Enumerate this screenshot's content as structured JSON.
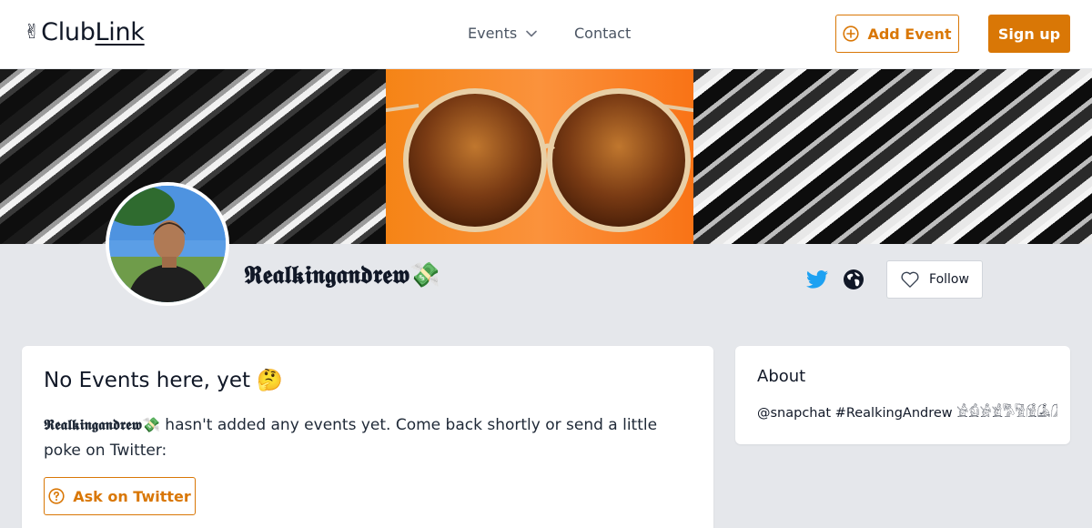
{
  "header": {
    "logo_emoji": "✌",
    "logo_text_a": "Club",
    "logo_text_b": "Link",
    "nav_events": "Events",
    "nav_contact": "Contact",
    "add_event": "Add Event",
    "sign_up": "Sign up"
  },
  "profile": {
    "name": "𝕽𝖊𝖆𝖑𝖐𝖎𝖓𝖌𝖆𝖓𝖉𝖗𝖊𝖜💸",
    "follow": "Follow"
  },
  "events_card": {
    "title": "No Events here, yet 🤔",
    "name_inline": "𝕽𝖊𝖆𝖑𝖐𝖎𝖓𝖌𝖆𝖓𝖉𝖗𝖊𝖜💸",
    "message": " hasn't added any events yet. Come back shortly or send a little poke on Twitter:",
    "ask_button": "Ask on Twitter"
  },
  "about_card": {
    "title": "About",
    "text": "@snapchat #RealkingAndrew 𓀀𓀁𓀂𓀃𓀄𓀅𓀆𓀇𓀈𓀉𓀊𓀋𓀌𓀍𓀎𓀏"
  },
  "colors": {
    "accent": "#d97706",
    "page_bg": "#e5e7eb",
    "twitter": "#1da1f2"
  },
  "icons": {
    "add_event": "plus-circle-icon",
    "nav_events": "chevron-down-icon",
    "twitter": "twitter-icon",
    "website": "globe-icon",
    "follow": "heart-outline-icon",
    "ask": "question-circle-icon"
  }
}
